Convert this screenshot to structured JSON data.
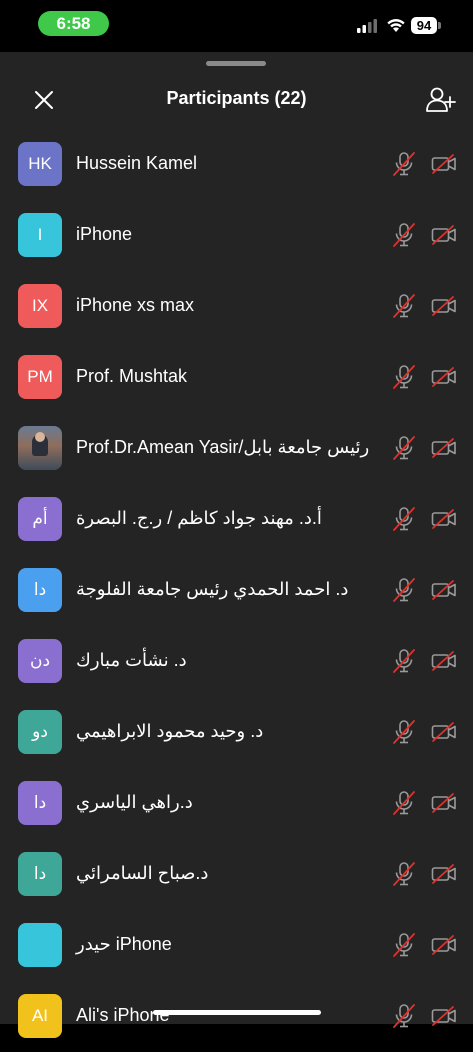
{
  "status_bar": {
    "time": "6:58",
    "battery": "94"
  },
  "colors": {
    "time_pill": "#3fc84a",
    "sheet_bg": "#242424",
    "muted_red": "#e0312b"
  },
  "header": {
    "title": "Participants (22)",
    "close_icon": "close-icon",
    "add_icon": "add-participant-icon"
  },
  "participants": [
    {
      "initials": "HK",
      "name": "Hussein Kamel",
      "color": "#6b74c6",
      "photo": false
    },
    {
      "initials": "I",
      "name": "iPhone",
      "color": "#36c5db",
      "photo": false
    },
    {
      "initials": "IX",
      "name": "iPhone xs max",
      "color": "#ef5a5a",
      "photo": false
    },
    {
      "initials": "PM",
      "name": "Prof. Mushtak",
      "color": "#ef5a5a",
      "photo": false
    },
    {
      "initials": "",
      "name": "Prof.Dr.Amean Yasir/رئيس جامعة بابل",
      "color": "#6a7b92",
      "photo": true
    },
    {
      "initials": "أم",
      "name": "أ.د. مهند جواد كاظم / ر.ج. البصرة",
      "color": "#8b6fd0",
      "photo": false
    },
    {
      "initials": "دا",
      "name": "د. احمد الحمدي رئيس جامعة الفلوجة",
      "color": "#4a9fef",
      "photo": false
    },
    {
      "initials": "دن",
      "name": "د. نشأت مبارك",
      "color": "#8b6fd0",
      "photo": false
    },
    {
      "initials": "دو",
      "name": "د. وحيد محمود الابراهيمي",
      "color": "#3ea798",
      "photo": false
    },
    {
      "initials": "دا",
      "name": "د.راهي الياسري",
      "color": "#8b6fd0",
      "photo": false
    },
    {
      "initials": "دا",
      "name": "د.صباح السامرائي",
      "color": "#3ea798",
      "photo": false
    },
    {
      "initials": "",
      "name": "حيدر iPhone",
      "color": "#36c5db",
      "photo": false
    },
    {
      "initials": "AI",
      "name": "Ali's iPhone",
      "color": "#f1c21b",
      "photo": false
    }
  ]
}
